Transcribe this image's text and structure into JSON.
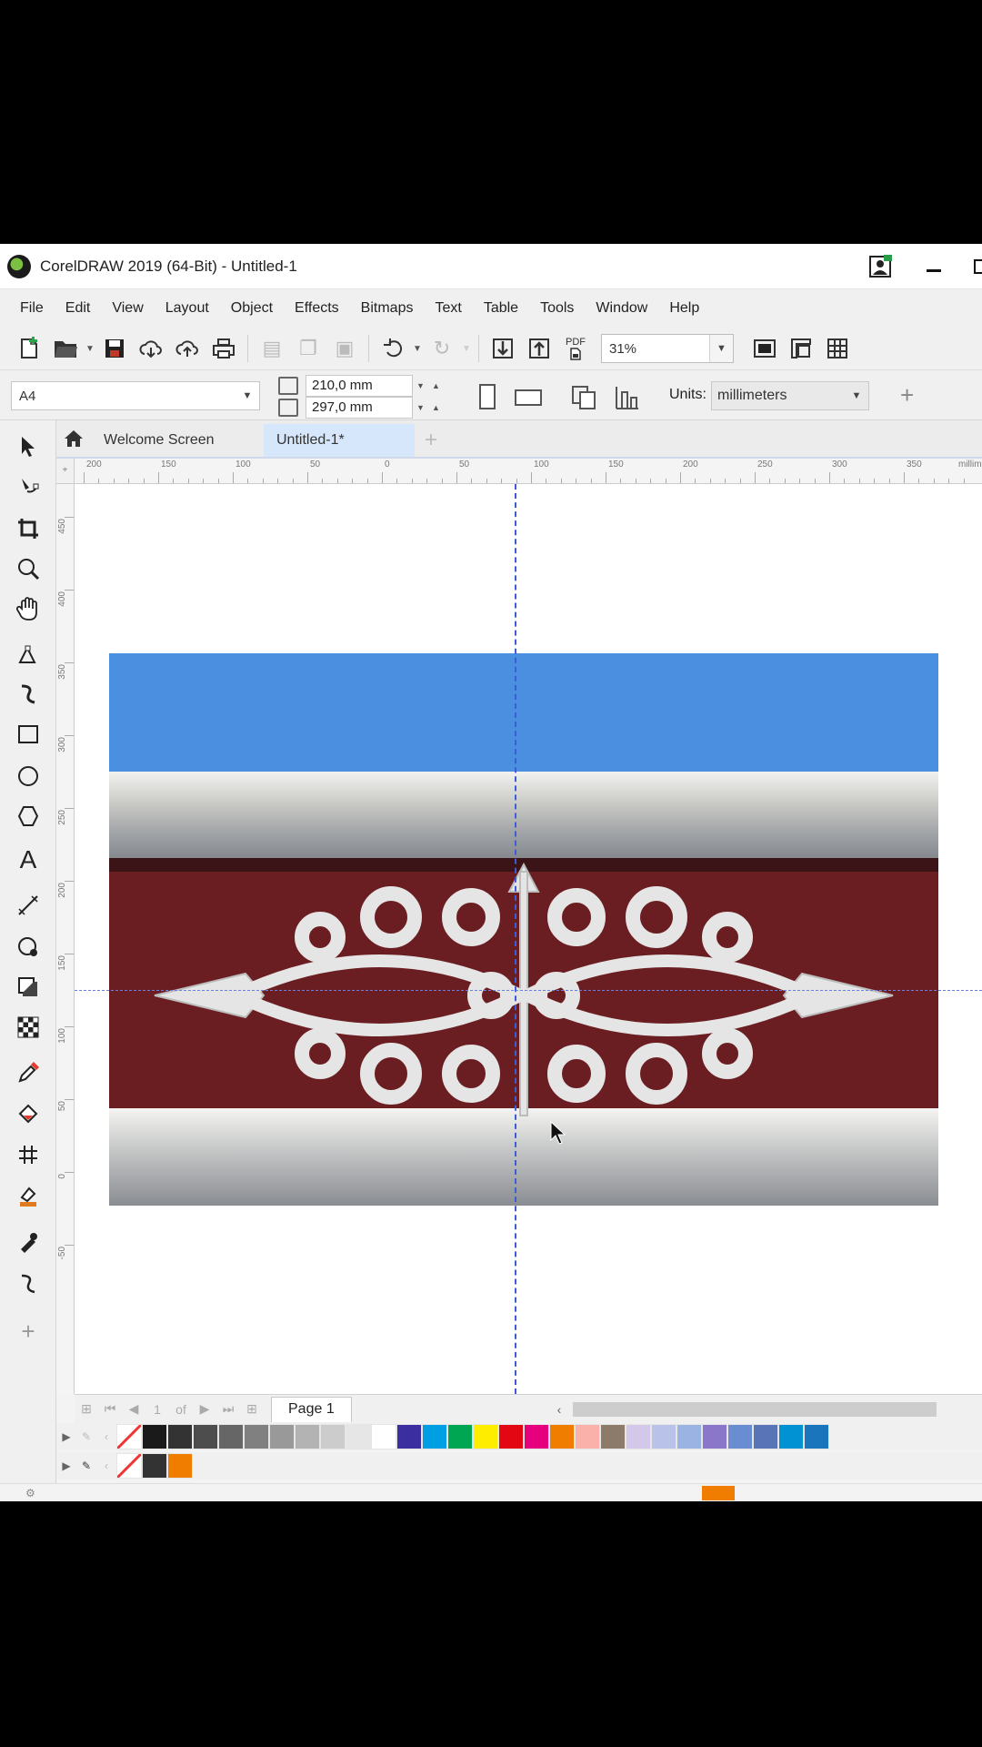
{
  "window": {
    "title": "CorelDRAW 2019 (64-Bit) - Untitled-1"
  },
  "menu": [
    "File",
    "Edit",
    "View",
    "Layout",
    "Object",
    "Effects",
    "Bitmaps",
    "Text",
    "Table",
    "Tools",
    "Window",
    "Help"
  ],
  "toolbar": {
    "pdf_label": "PDF",
    "zoom_value": "31%"
  },
  "property_bar": {
    "page_size": "A4",
    "width": "210,0 mm",
    "height": "297,0 mm",
    "units_label": "Units:",
    "units_value": "millimeters"
  },
  "tabs": {
    "welcome": "Welcome Screen",
    "document": "Untitled-1*",
    "add": "+"
  },
  "ruler": {
    "h_labels": [
      "200",
      "150",
      "100",
      "50",
      "0",
      "50",
      "100",
      "150",
      "200",
      "250",
      "300",
      "350"
    ],
    "h_unit": "millimeters",
    "v_labels": [
      "450",
      "400",
      "350",
      "300",
      "250",
      "200",
      "150",
      "100",
      "50",
      "0",
      "-50"
    ]
  },
  "page_nav": {
    "current": "1",
    "of_label": "of",
    "page_tab": "Page 1"
  },
  "palette_colors": [
    "#1a1a1a",
    "#333333",
    "#4d4d4d",
    "#666666",
    "#808080",
    "#999999",
    "#b3b3b3",
    "#cccccc",
    "#e6e6e6",
    "#ffffff",
    "#3a2ea0",
    "#009fe3",
    "#00a651",
    "#ffed00",
    "#e30613",
    "#e6007e",
    "#f07d00",
    "#f9b1a9",
    "#8c7b6b",
    "#d4c8ea",
    "#b9c3ea",
    "#9bb3e3",
    "#8b77c9",
    "#6a8dd1",
    "#5a74b8",
    "#0092d2",
    "#1b75bc"
  ],
  "document_palette": [
    "#333333",
    "#f07d00"
  ],
  "colors": {
    "sky": "#4a8fe0",
    "wall": "#6b1e22",
    "ornament": "#e5e5e5",
    "guide": "#3b5ed8",
    "tab_active": "#d6e6fb"
  }
}
